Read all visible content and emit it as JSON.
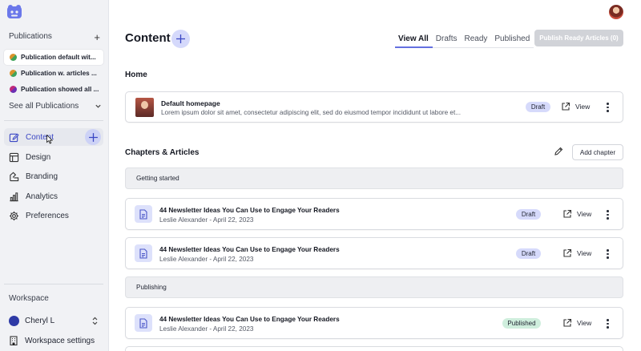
{
  "sidebar": {
    "publications_heading": "Publications",
    "add_symbol": "+",
    "publications": [
      {
        "label": "Publication default wit...",
        "color_a": "#d9922b",
        "color_b": "#3fa35a"
      },
      {
        "label": "Publication w. articles ...",
        "color_a": "#d9922b",
        "color_b": "#3fa35a"
      },
      {
        "label": "Publication showed all ...",
        "color_a": "#c0287a",
        "color_b": "#6b2fb3"
      }
    ],
    "see_all_label": "See all Publications",
    "nav": [
      {
        "label": "Content",
        "icon": "edit-icon"
      },
      {
        "label": "Design",
        "icon": "design-icon"
      },
      {
        "label": "Branding",
        "icon": "branding-icon"
      },
      {
        "label": "Analytics",
        "icon": "analytics-icon"
      },
      {
        "label": "Preferences",
        "icon": "gear-icon"
      }
    ],
    "workspace_heading": "Workspace",
    "workspace_user": "Cheryl L",
    "workspace_settings_label": "Workspace settings"
  },
  "main": {
    "title": "Content",
    "tabs": [
      {
        "label": "View All",
        "active": true
      },
      {
        "label": "Drafts",
        "active": false
      },
      {
        "label": "Ready",
        "active": false
      },
      {
        "label": "Published",
        "active": false
      }
    ],
    "publish_button": "Publish Ready Articles (0)",
    "home_heading": "Home",
    "home_card": {
      "title": "Default homepage",
      "subtitle": "Lorem ipsum dolor sit amet, consectetur adipiscing elit, sed do eiusmod tempor incididunt ut labore et...",
      "status": "Draft",
      "view_label": "View"
    },
    "chapters_heading": "Chapters & Articles",
    "add_chapter_label": "Add chapter",
    "chapters": [
      {
        "name": "Getting started",
        "articles": [
          {
            "title": "44 Newsletter Ideas You Can Use to Engage Your Readers",
            "meta": "Leslie Alexander - April 22, 2023",
            "status": "Draft",
            "view_label": "View"
          },
          {
            "title": "44 Newsletter Ideas You Can Use to Engage Your Readers",
            "meta": "Leslie Alexander - April 22, 2023",
            "status": "Draft",
            "view_label": "View"
          }
        ]
      },
      {
        "name": "Publishing",
        "articles": [
          {
            "title": "44 Newsletter Ideas You Can Use to Engage Your Readers",
            "meta": "Leslie Alexander - April 22, 2023",
            "status": "Published",
            "view_label": "View"
          }
        ]
      }
    ]
  },
  "colors": {
    "accent": "#3b47c4",
    "draft_badge": "#d6dafb",
    "published_badge": "#cfeedd",
    "sidebar_bg": "#f1f2f5"
  }
}
